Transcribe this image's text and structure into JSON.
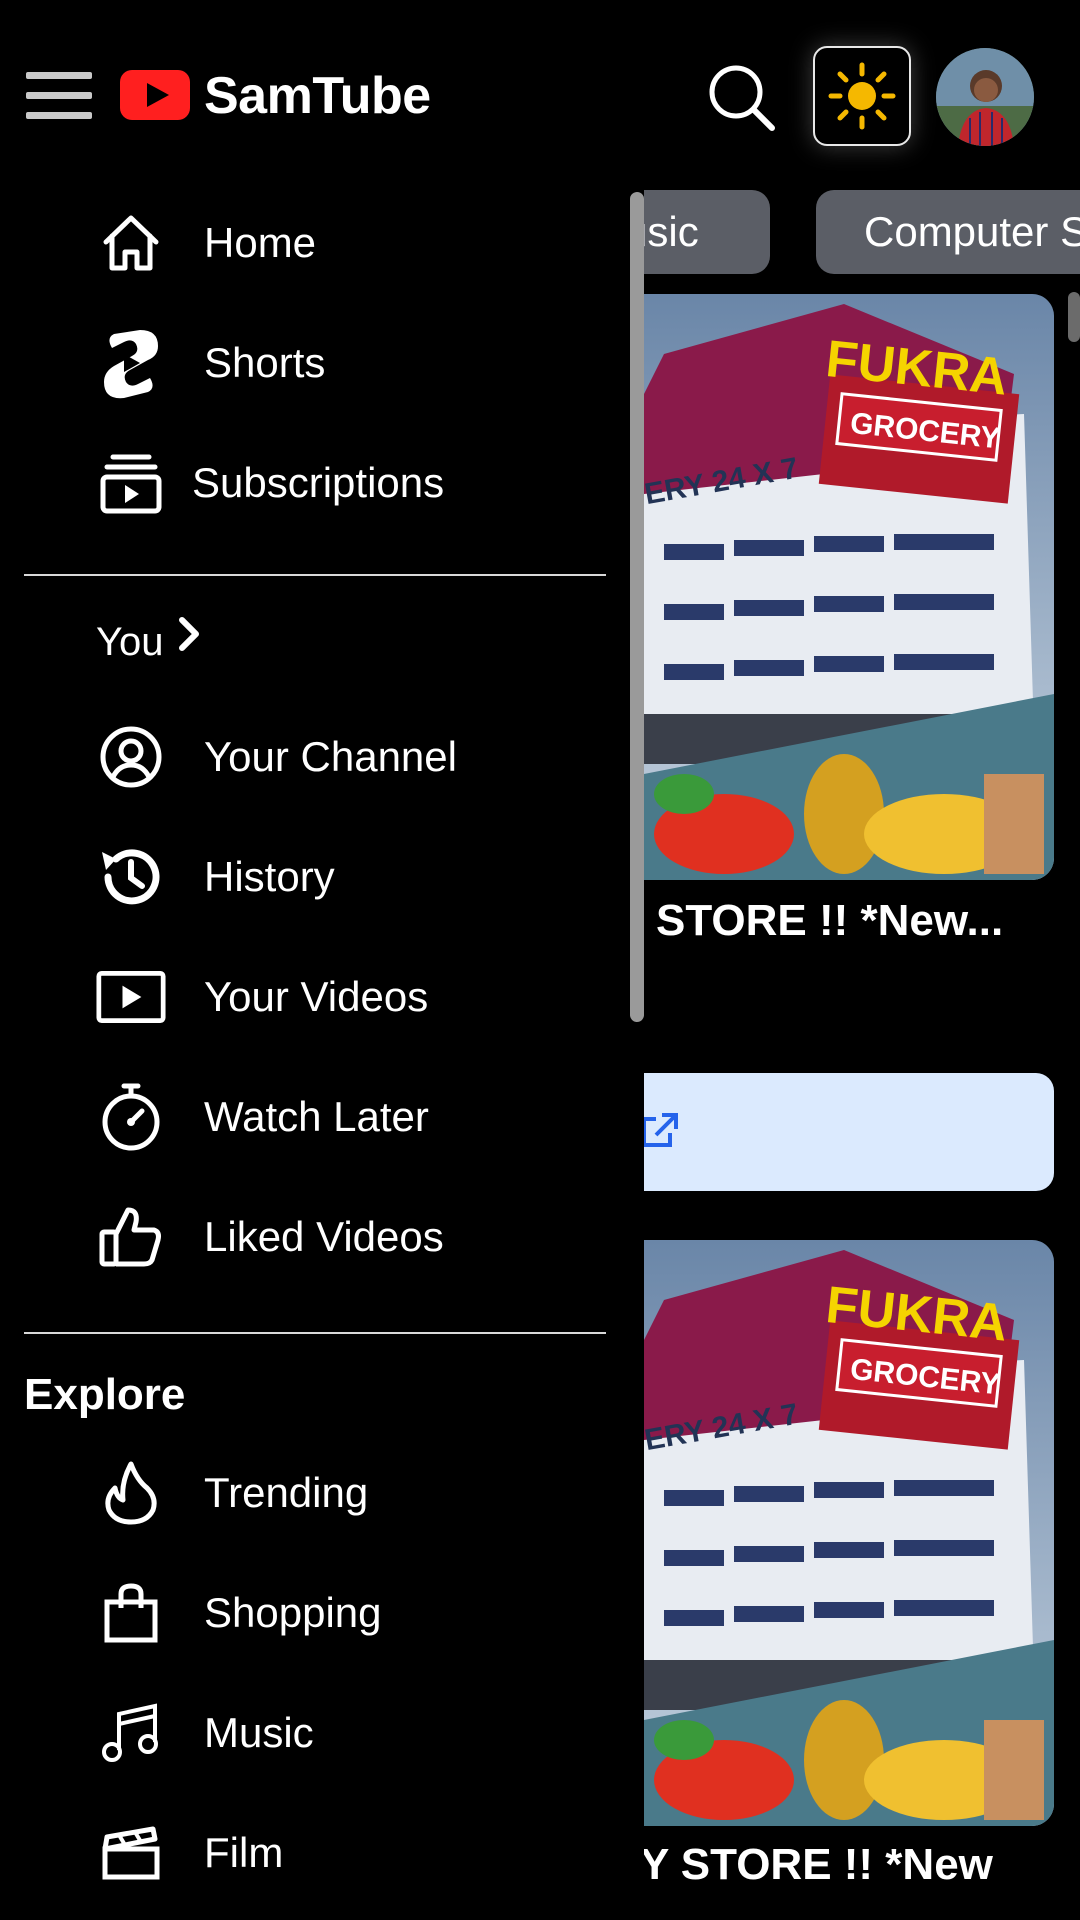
{
  "header": {
    "logo_text": "SamTube"
  },
  "sidebar": {
    "main_items": [
      {
        "label": "Home"
      },
      {
        "label": "Shorts"
      },
      {
        "label": "Subscriptions"
      }
    ],
    "you_label": "You",
    "you_items": [
      {
        "label": "Your Channel"
      },
      {
        "label": "History"
      },
      {
        "label": "Your Videos"
      },
      {
        "label": "Watch Later"
      },
      {
        "label": "Liked Videos"
      }
    ],
    "explore_title": "Explore",
    "explore_items": [
      {
        "label": "Trending"
      },
      {
        "label": "Shopping"
      },
      {
        "label": "Music"
      },
      {
        "label": "Film"
      }
    ]
  },
  "content": {
    "chips": [
      {
        "label": "usic"
      },
      {
        "label": "Computer S"
      }
    ],
    "thumbnail_text": {
      "line1": "FUKRA",
      "line2": "GROCERY",
      "side": "ERY 24 X 7"
    },
    "videos": [
      {
        "title": "STORE !! *New..."
      },
      {
        "title": "Y STORE !! *New"
      }
    ]
  },
  "colors": {
    "background": "#000000",
    "chip_bg": "#5b5e66",
    "logo_red": "#ff1f1f",
    "sun_yellow": "#f5b800",
    "ad_bg": "#dbeafe",
    "ad_icon": "#2563eb"
  },
  "icons": [
    "menu-icon",
    "play-logo-icon",
    "search-icon",
    "sun-icon",
    "home-icon",
    "shorts-icon",
    "subscriptions-icon",
    "chevron-right-icon",
    "user-circle-icon",
    "history-icon",
    "video-play-icon",
    "stopwatch-icon",
    "thumbs-up-icon",
    "flame-icon",
    "shopping-bag-icon",
    "music-note-icon",
    "clapperboard-icon",
    "external-link-icon"
  ]
}
